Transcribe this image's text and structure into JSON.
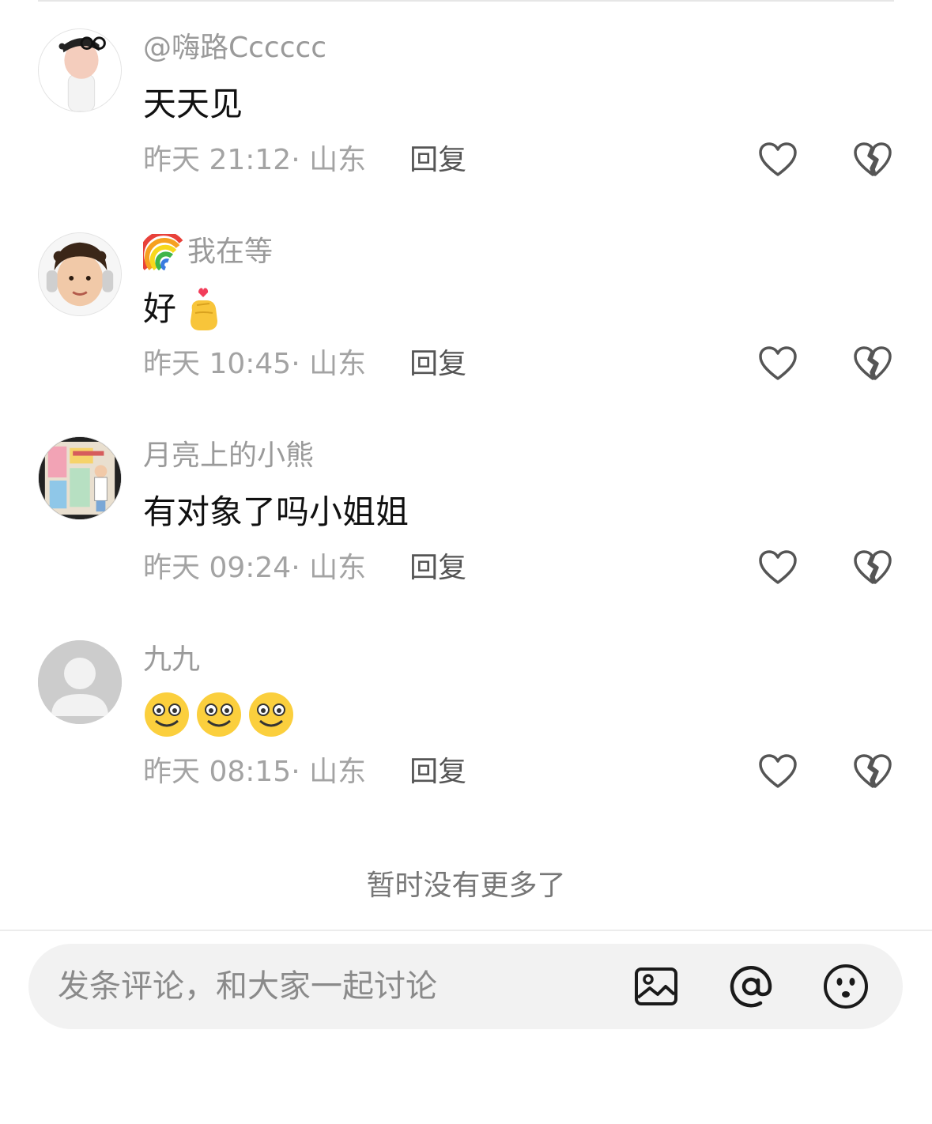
{
  "comments": [
    {
      "username": "@嗨路Cccccc",
      "content": "天天见",
      "meta": "昨天 21:12· 山东",
      "reply_label": "回复"
    },
    {
      "username": "我在等",
      "username_prefix_emoji": "rainbow-emoji",
      "content": "好",
      "content_emoji": "finger-heart-emoji",
      "meta": "昨天 10:45· 山东",
      "reply_label": "回复"
    },
    {
      "username": "月亮上的小熊",
      "content": "有对象了吗小姐姐",
      "meta": "昨天 09:24· 山东",
      "reply_label": "回复"
    },
    {
      "username": "九九",
      "content_emojis": [
        "smile-emoji",
        "smile-emoji",
        "smile-emoji"
      ],
      "meta": "昨天 08:15· 山东",
      "reply_label": "回复"
    }
  ],
  "footer_text": "暂时没有更多了",
  "input": {
    "placeholder": "发条评论，和大家一起讨论"
  },
  "icons": {
    "like": "heart-outline-icon",
    "dislike": "broken-heart-icon",
    "image": "image-icon",
    "mention": "at-icon",
    "emoji": "emoji-face-icon"
  },
  "colors": {
    "username": "#9a9a9a",
    "meta": "#a3a3a3",
    "reply": "#555555",
    "icon": "#555555",
    "input_bg": "#f2f2f2"
  }
}
